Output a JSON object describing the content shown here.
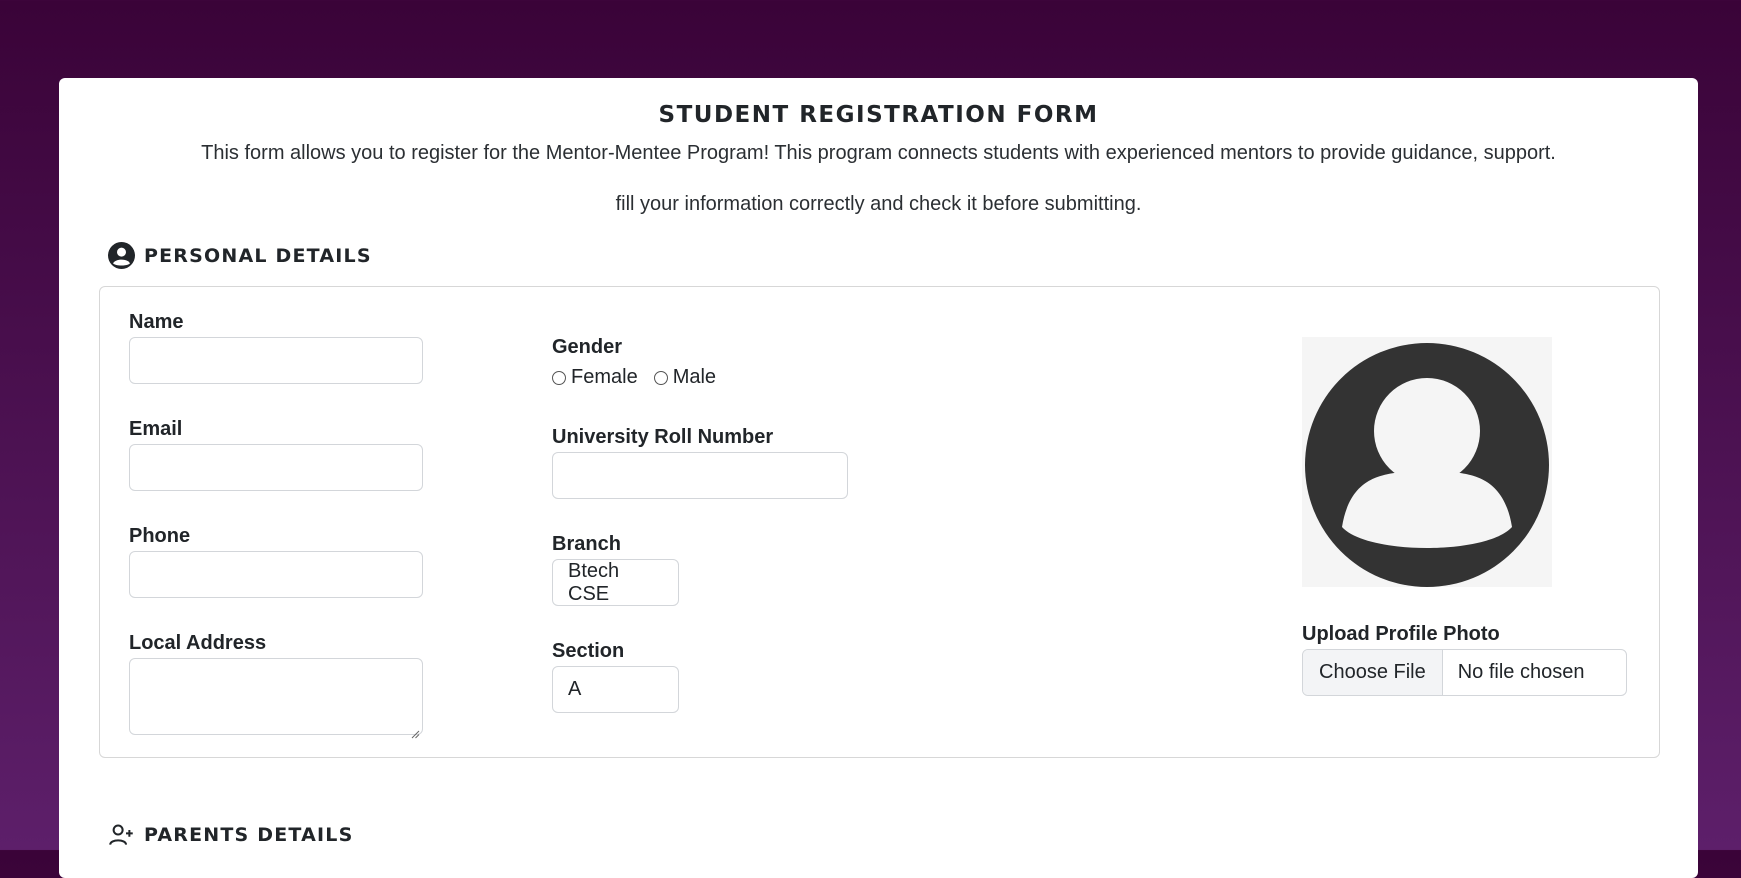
{
  "form": {
    "title": "STUDENT REGISTRATION FORM",
    "description": "This form allows you to register for the Mentor-Mentee Program! This program connects students with experienced mentors to provide guidance, support.",
    "instruction": "fill your information correctly and check it before submitting."
  },
  "personal": {
    "heading": "PERSONAL DETAILS",
    "icon": "user-circle-icon",
    "name_label": "Name",
    "name_value": "",
    "email_label": "Email",
    "email_value": "",
    "phone_label": "Phone",
    "phone_value": "",
    "address_label": "Local Address",
    "address_value": "",
    "gender_label": "Gender",
    "gender_options": [
      "Female",
      "Male"
    ],
    "roll_label": "University Roll Number",
    "roll_value": "",
    "branch_label": "Branch",
    "branch_value": "Btech CSE",
    "section_label": "Section",
    "section_value": "A",
    "photo_icon": "profile-placeholder-icon",
    "upload_label": "Upload Profile Photo",
    "choose_file_label": "Choose File",
    "file_status": "No file chosen"
  },
  "parents": {
    "heading": "PARENTS DETAILS",
    "icon": "user-plus-icon"
  },
  "colors": {
    "background_top": "#3a0338",
    "background_bottom": "#5d1f6a",
    "card": "#ffffff",
    "text": "#212529"
  }
}
